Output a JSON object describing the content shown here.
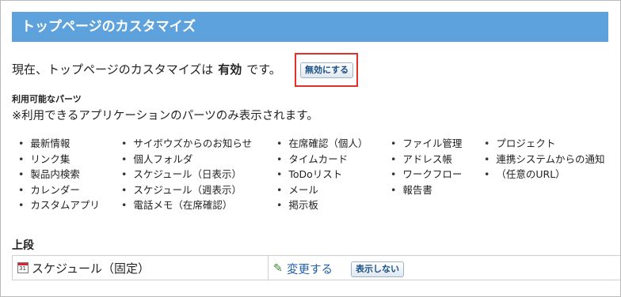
{
  "header": {
    "title": "トップページのカスタマイズ"
  },
  "status": {
    "prefix": "現在、トップページのカスタマイズは",
    "value": "有効",
    "suffix": "です。",
    "toggle_button": "無効にする"
  },
  "parts": {
    "title": "利用可能なパーツ",
    "note": "※利用できるアプリケーションのパーツのみ表示されます。",
    "columns": [
      [
        "最新情報",
        "リンク集",
        "製品内検索",
        "カレンダー",
        "カスタムアプリ"
      ],
      [
        "サイボウズからのお知らせ",
        "個人フォルダ",
        "スケジュール（日表示）",
        "スケジュール（週表示）",
        "電話メモ（在席確認）"
      ],
      [
        "在席確認（個人）",
        "タイムカード",
        "ToDoリスト",
        "メール",
        "掲示板"
      ],
      [
        "ファイル管理",
        "アドレス帳",
        "ワークフロー",
        "報告書"
      ],
      [
        "プロジェクト",
        "連携システムからの通知",
        "（任意のURL）"
      ]
    ]
  },
  "upper": {
    "title": "上段",
    "rows": [
      {
        "name": "スケジュール（固定）",
        "icon_day": "31",
        "change_label": "変更する",
        "hide_label": "表示しない"
      }
    ]
  },
  "colors": {
    "header_bg": "#5ea2dd",
    "highlight": "#e0302a",
    "link": "#1f5fa8"
  },
  "icons": {
    "calendar": "calendar-icon",
    "edit": "pencil-icon"
  }
}
